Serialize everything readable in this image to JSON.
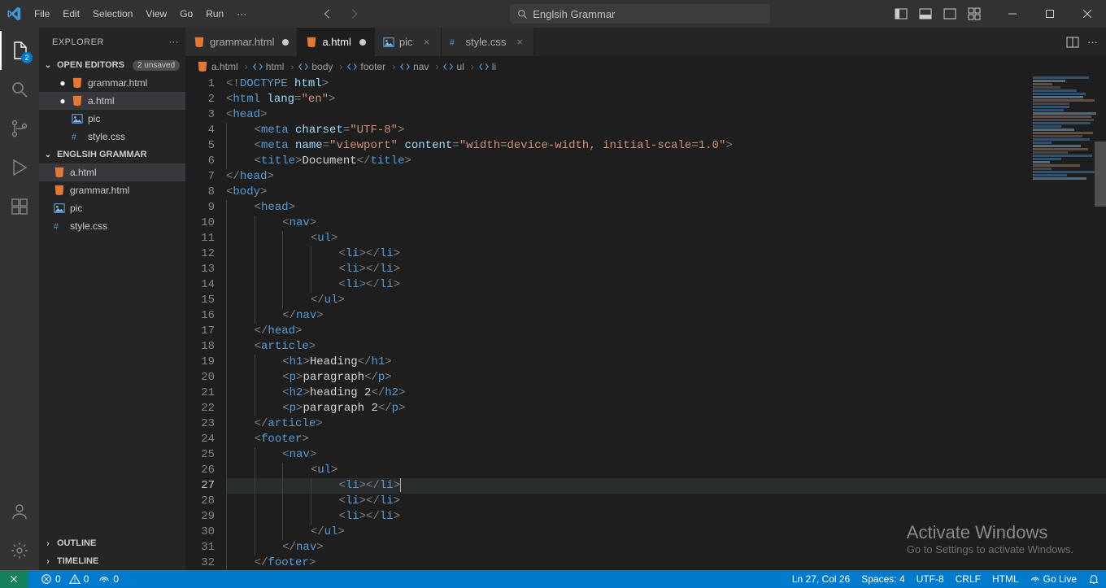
{
  "menu": [
    "File",
    "Edit",
    "Selection",
    "View",
    "Go",
    "Run"
  ],
  "search_placeholder": "Englsih Grammar",
  "activity_badge": "2",
  "sidebar": {
    "title": "EXPLORER",
    "open_editors_label": "OPEN EDITORS",
    "unsaved_badge": "2 unsaved",
    "open_editors": [
      {
        "label": "grammar.html",
        "icon": "html",
        "dirty": true
      },
      {
        "label": "a.html",
        "icon": "html",
        "dirty": true,
        "selected": true
      },
      {
        "label": "pic",
        "icon": "image",
        "dirty": false
      },
      {
        "label": "style.css",
        "icon": "css",
        "dirty": false
      }
    ],
    "folder_label": "ENGLSIH GRAMMAR",
    "folder_items": [
      {
        "label": "a.html",
        "icon": "html",
        "selected": true
      },
      {
        "label": "grammar.html",
        "icon": "html"
      },
      {
        "label": "pic",
        "icon": "image"
      },
      {
        "label": "style.css",
        "icon": "css"
      }
    ],
    "outline_label": "OUTLINE",
    "timeline_label": "TIMELINE"
  },
  "tabs": [
    {
      "label": "grammar.html",
      "icon": "html",
      "dirty": true
    },
    {
      "label": "a.html",
      "icon": "html",
      "active": true,
      "dirty": true
    },
    {
      "label": "pic",
      "icon": "image"
    },
    {
      "label": "style.css",
      "icon": "css"
    }
  ],
  "breadcrumbs": [
    {
      "label": "a.html",
      "kind": "file"
    },
    {
      "label": "html",
      "kind": "elem"
    },
    {
      "label": "body",
      "kind": "elem"
    },
    {
      "label": "footer",
      "kind": "elem"
    },
    {
      "label": "nav",
      "kind": "elem"
    },
    {
      "label": "ul",
      "kind": "elem"
    },
    {
      "label": "li",
      "kind": "elem"
    }
  ],
  "code_lines": [
    {
      "n": 1,
      "html": "<span class='c-punct'>&lt;!</span><span class='c-doctype'>DOCTYPE</span> <span class='c-attr'>html</span><span class='c-punct'>&gt;</span>"
    },
    {
      "n": 2,
      "html": "<span class='c-punct'>&lt;</span><span class='c-tag'>html</span> <span class='c-attr'>lang</span><span class='c-punct'>=</span><span class='c-str'>\"en\"</span><span class='c-punct'>&gt;</span>"
    },
    {
      "n": 3,
      "html": "<span class='c-punct'>&lt;</span><span class='c-tag'>head</span><span class='c-punct'>&gt;</span>"
    },
    {
      "n": 4,
      "indent": 1,
      "html": "<span class='c-punct'>&lt;</span><span class='c-tag'>meta</span> <span class='c-attr'>charset</span><span class='c-punct'>=</span><span class='c-str'>\"UTF-8\"</span><span class='c-punct'>&gt;</span>"
    },
    {
      "n": 5,
      "indent": 1,
      "html": "<span class='c-punct'>&lt;</span><span class='c-tag'>meta</span> <span class='c-attr'>name</span><span class='c-punct'>=</span><span class='c-str'>\"viewport\"</span> <span class='c-attr'>content</span><span class='c-punct'>=</span><span class='c-str'>\"width=device-width, initial-scale=1.0\"</span><span class='c-punct'>&gt;</span>"
    },
    {
      "n": 6,
      "indent": 1,
      "html": "<span class='c-punct'>&lt;</span><span class='c-tag'>title</span><span class='c-punct'>&gt;</span><span class='c-text'>Document</span><span class='c-punct'>&lt;/</span><span class='c-tag'>title</span><span class='c-punct'>&gt;</span>"
    },
    {
      "n": 7,
      "html": "<span class='c-punct'>&lt;/</span><span class='c-tag'>head</span><span class='c-punct'>&gt;</span>"
    },
    {
      "n": 8,
      "html": "<span class='c-punct'>&lt;</span><span class='c-tag'>body</span><span class='c-punct'>&gt;</span>"
    },
    {
      "n": 9,
      "indent": 1,
      "html": "<span class='c-punct'>&lt;</span><span class='c-tag'>head</span><span class='c-punct'>&gt;</span>"
    },
    {
      "n": 10,
      "indent": 2,
      "html": "<span class='c-punct'>&lt;</span><span class='c-tag'>nav</span><span class='c-punct'>&gt;</span>"
    },
    {
      "n": 11,
      "indent": 3,
      "html": "<span class='c-punct'>&lt;</span><span class='c-tag'>ul</span><span class='c-punct'>&gt;</span>"
    },
    {
      "n": 12,
      "indent": 4,
      "html": "<span class='c-punct'>&lt;</span><span class='c-tag'>li</span><span class='c-punct'>&gt;&lt;/</span><span class='c-tag'>li</span><span class='c-punct'>&gt;</span>"
    },
    {
      "n": 13,
      "indent": 4,
      "html": "<span class='c-punct'>&lt;</span><span class='c-tag'>li</span><span class='c-punct'>&gt;&lt;/</span><span class='c-tag'>li</span><span class='c-punct'>&gt;</span>"
    },
    {
      "n": 14,
      "indent": 4,
      "html": "<span class='c-punct'>&lt;</span><span class='c-tag'>li</span><span class='c-punct'>&gt;&lt;/</span><span class='c-tag'>li</span><span class='c-punct'>&gt;</span>"
    },
    {
      "n": 15,
      "indent": 3,
      "html": "<span class='c-punct'>&lt;/</span><span class='c-tag'>ul</span><span class='c-punct'>&gt;</span>"
    },
    {
      "n": 16,
      "indent": 2,
      "html": "<span class='c-punct'>&lt;/</span><span class='c-tag'>nav</span><span class='c-punct'>&gt;</span>"
    },
    {
      "n": 17,
      "indent": 1,
      "html": "<span class='c-punct'>&lt;/</span><span class='c-tag'>head</span><span class='c-punct'>&gt;</span>"
    },
    {
      "n": 18,
      "indent": 1,
      "html": "<span class='c-punct'>&lt;</span><span class='c-tag'>article</span><span class='c-punct'>&gt;</span>"
    },
    {
      "n": 19,
      "indent": 2,
      "html": "<span class='c-punct'>&lt;</span><span class='c-tag'>h1</span><span class='c-punct'>&gt;</span><span class='c-text'>Heading</span><span class='c-punct'>&lt;/</span><span class='c-tag'>h1</span><span class='c-punct'>&gt;</span>"
    },
    {
      "n": 20,
      "indent": 2,
      "html": "<span class='c-punct'>&lt;</span><span class='c-tag'>p</span><span class='c-punct'>&gt;</span><span class='c-text'>paragraph</span><span class='c-punct'>&lt;/</span><span class='c-tag'>p</span><span class='c-punct'>&gt;</span>"
    },
    {
      "n": 21,
      "indent": 2,
      "html": "<span class='c-punct'>&lt;</span><span class='c-tag'>h2</span><span class='c-punct'>&gt;</span><span class='c-text'>heading 2</span><span class='c-punct'>&lt;/</span><span class='c-tag'>h2</span><span class='c-punct'>&gt;</span>"
    },
    {
      "n": 22,
      "indent": 2,
      "html": "<span class='c-punct'>&lt;</span><span class='c-tag'>p</span><span class='c-punct'>&gt;</span><span class='c-text'>paragraph 2</span><span class='c-punct'>&lt;/</span><span class='c-tag'>p</span><span class='c-punct'>&gt;</span>"
    },
    {
      "n": 23,
      "indent": 1,
      "html": "<span class='c-punct'>&lt;/</span><span class='c-tag'>article</span><span class='c-punct'>&gt;</span>"
    },
    {
      "n": 24,
      "indent": 1,
      "html": "<span class='c-punct'>&lt;</span><span class='c-tag'>footer</span><span class='c-punct'>&gt;</span>"
    },
    {
      "n": 25,
      "indent": 2,
      "html": "<span class='c-punct'>&lt;</span><span class='c-tag'>nav</span><span class='c-punct'>&gt;</span>"
    },
    {
      "n": 26,
      "indent": 3,
      "html": "<span class='c-punct'>&lt;</span><span class='c-tag'>ul</span><span class='c-punct'>&gt;</span>"
    },
    {
      "n": 27,
      "indent": 4,
      "current": true,
      "html": "<span class='c-punct'>&lt;</span><span class='c-tag'>li</span><span class='c-punct'>&gt;&lt;/</span><span class='c-tag'>li</span><span class='c-punct'>&gt;</span><span class='cursor'></span>"
    },
    {
      "n": 28,
      "indent": 4,
      "html": "<span class='c-punct'>&lt;</span><span class='c-tag'>li</span><span class='c-punct'>&gt;&lt;/</span><span class='c-tag'>li</span><span class='c-punct'>&gt;</span>"
    },
    {
      "n": 29,
      "indent": 4,
      "html": "<span class='c-punct'>&lt;</span><span class='c-tag'>li</span><span class='c-punct'>&gt;&lt;/</span><span class='c-tag'>li</span><span class='c-punct'>&gt;</span>"
    },
    {
      "n": 30,
      "indent": 3,
      "html": "<span class='c-punct'>&lt;/</span><span class='c-tag'>ul</span><span class='c-punct'>&gt;</span>"
    },
    {
      "n": 31,
      "indent": 2,
      "html": "<span class='c-punct'>&lt;/</span><span class='c-tag'>nav</span><span class='c-punct'>&gt;</span>"
    },
    {
      "n": 32,
      "indent": 1,
      "html": "<span class='c-punct'>&lt;/</span><span class='c-tag'>footer</span><span class='c-punct'>&gt;</span>"
    }
  ],
  "status": {
    "errors": "0",
    "warnings": "0",
    "ports": "0",
    "cursor": "Ln 27, Col 26",
    "spaces": "Spaces: 4",
    "encoding": "UTF-8",
    "eol": "CRLF",
    "lang": "HTML",
    "golive": "Go Live"
  },
  "watermark": {
    "title": "Activate Windows",
    "subtitle": "Go to Settings to activate Windows."
  }
}
